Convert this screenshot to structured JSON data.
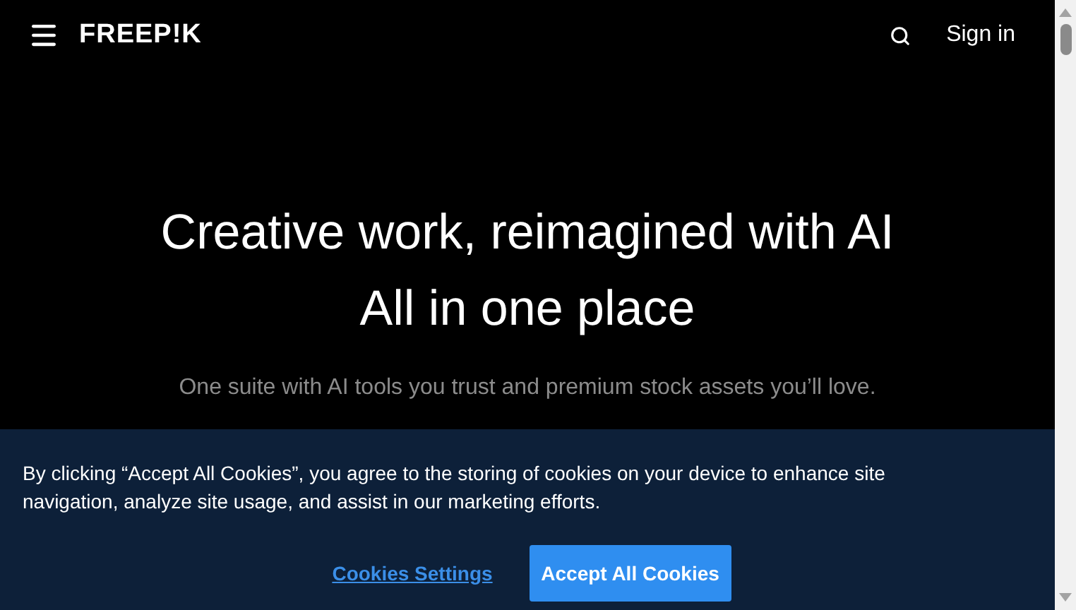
{
  "header": {
    "logo": "FREEP!K",
    "sign_in": "Sign in"
  },
  "hero": {
    "title_lines": [
      "Creative work, reimagined with AI",
      "All in one place"
    ],
    "subtitle": "One suite with AI tools you trust and premium stock assets you’ll love."
  },
  "cookie_banner": {
    "text": "By clicking “Accept All Cookies”, you agree to the storing of cookies on your device to enhance site navigation, analyze site usage, and assist in our marketing efforts.",
    "settings_link": "Cookies Settings",
    "accept_button": "Accept All Cookies"
  }
}
